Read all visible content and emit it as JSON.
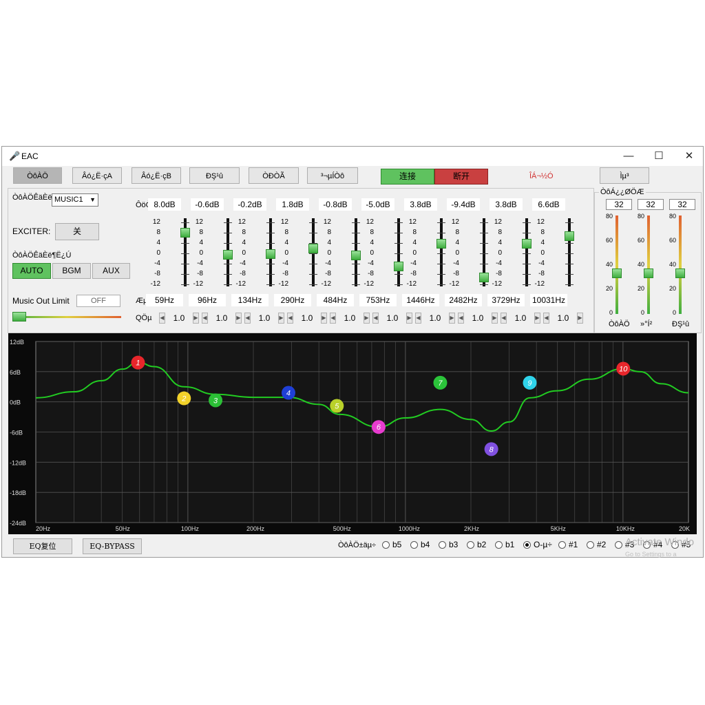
{
  "window": {
    "title": "EAC",
    "mic_icon": "microphone-icon"
  },
  "tabs": [
    {
      "label": "ÒôÀÖ"
    },
    {
      "label": "Âó¿Ë·çA"
    },
    {
      "label": "Âó¿Ë·çB"
    },
    {
      "label": "ÐŞ¹û"
    },
    {
      "label": "ÒÐÒÃ"
    },
    {
      "label": "³¬µÍÒô"
    }
  ],
  "connect_label": "连接",
  "disconnect_label": "断开",
  "status_text": "ÎÁ¬½Ó",
  "last_tab_label": "Ìµ³",
  "left_panel": {
    "source_label": "ÒôÀÖÊäÈë",
    "source_value": "MUSIC1",
    "exciter_label": "EXCITER:",
    "exciter_value": "关",
    "mode_label": "ÒôÀÖÊäÈë¶Ë¿Ú",
    "modes": [
      "AUTO",
      "BGM",
      "AUX"
    ],
    "active_mode": "AUTO",
    "limit_label": "Music Out Limit",
    "limit_value": "OFF"
  },
  "eq": {
    "gain_label": "ÔöÒæ",
    "freq_label": "ÆµÂÊ",
    "q_label": "QÖµ",
    "scale": [
      "12",
      "8",
      "4",
      "0",
      "-4",
      "-8",
      "-12"
    ],
    "bands": [
      {
        "gain": "8.0dB",
        "freq": "59Hz",
        "q": "1.0",
        "level": 8.0
      },
      {
        "gain": "-0.6dB",
        "freq": "96Hz",
        "q": "1.0",
        "level": -0.6
      },
      {
        "gain": "-0.2dB",
        "freq": "134Hz",
        "q": "1.0",
        "level": -0.2
      },
      {
        "gain": "1.8dB",
        "freq": "290Hz",
        "q": "1.0",
        "level": 1.8
      },
      {
        "gain": "-0.8dB",
        "freq": "484Hz",
        "q": "1.0",
        "level": -0.8
      },
      {
        "gain": "-5.0dB",
        "freq": "753Hz",
        "q": "1.0",
        "level": -5.0
      },
      {
        "gain": "3.8dB",
        "freq": "1446Hz",
        "q": "1.0",
        "level": 3.8
      },
      {
        "gain": "-9.4dB",
        "freq": "2482Hz",
        "q": "1.0",
        "level": -9.4
      },
      {
        "gain": "3.8dB",
        "freq": "3729Hz",
        "q": "1.0",
        "level": 3.8
      },
      {
        "gain": "6.6dB",
        "freq": "10031Hz",
        "q": "1.0",
        "level": 6.6
      }
    ]
  },
  "volume": {
    "title": "ÒôÁ¿¿ØÖÆ",
    "scale": [
      "80",
      "60",
      "40",
      "20",
      "0"
    ],
    "channels": [
      {
        "value": "32",
        "label": "ÒôÀÖ",
        "level": 32
      },
      {
        "value": "32",
        "label": "»°Í²",
        "level": 32
      },
      {
        "value": "32",
        "label": "ÐŞ¹û",
        "level": 32
      }
    ]
  },
  "graph": {
    "y_labels": [
      "12dB",
      "6dB",
      "0dB",
      "-6dB",
      "-12dB",
      "-18dB",
      "-24dB"
    ],
    "x_labels": [
      "20Hz",
      "50Hz",
      "100Hz",
      "200Hz",
      "500Hz",
      "1000Hz",
      "2KHz",
      "5KHz",
      "10KHz",
      "20K"
    ],
    "line_color": "#22cc22",
    "points": [
      {
        "n": "1",
        "color": "#e8262b",
        "freq": 59,
        "db": 7.8
      },
      {
        "n": "2",
        "color": "#f2d22a",
        "freq": 96,
        "db": 0.7
      },
      {
        "n": "3",
        "color": "#2bbf36",
        "freq": 134,
        "db": 0.3
      },
      {
        "n": "4",
        "color": "#1f3fd6",
        "freq": 290,
        "db": 1.8
      },
      {
        "n": "5",
        "color": "#b9d12a",
        "freq": 484,
        "db": -0.8
      },
      {
        "n": "6",
        "color": "#e83ccf",
        "freq": 753,
        "db": -5.0
      },
      {
        "n": "7",
        "color": "#2bc43a",
        "freq": 1446,
        "db": 3.8
      },
      {
        "n": "8",
        "color": "#8050e0",
        "freq": 2482,
        "db": -9.4
      },
      {
        "n": "9",
        "color": "#2fd3ea",
        "freq": 3729,
        "db": 3.8
      },
      {
        "n": "10",
        "color": "#e8262b",
        "freq": 10031,
        "db": 6.6
      }
    ],
    "curve": [
      [
        20,
        0.8
      ],
      [
        30,
        2.0
      ],
      [
        40,
        4.2
      ],
      [
        50,
        6.5
      ],
      [
        59,
        7.9
      ],
      [
        70,
        7.0
      ],
      [
        96,
        3.0
      ],
      [
        134,
        1.5
      ],
      [
        200,
        0.9
      ],
      [
        290,
        0.9
      ],
      [
        400,
        -0.5
      ],
      [
        500,
        -2.5
      ],
      [
        753,
        -5.0
      ],
      [
        1000,
        -3.2
      ],
      [
        1446,
        -1.5
      ],
      [
        2000,
        -3.5
      ],
      [
        2482,
        -5.8
      ],
      [
        3000,
        -4.0
      ],
      [
        3729,
        0.8
      ],
      [
        5000,
        2.2
      ],
      [
        7000,
        4.5
      ],
      [
        10031,
        6.6
      ],
      [
        12000,
        6.0
      ],
      [
        15000,
        3.6
      ],
      [
        20000,
        1.8
      ]
    ]
  },
  "bottom": {
    "reset_label": "EQ复位",
    "bypass_label": "EQ-BYPASS",
    "preset_label": "ÒôÀÖ±äµ÷",
    "presets": [
      "b5",
      "b4",
      "b3",
      "b2",
      "b1",
      "O-µ÷",
      "#1",
      "#2",
      "#3",
      "#4",
      "#5"
    ],
    "selected_preset": "O-µ÷"
  },
  "watermark": {
    "line1": "Activate Windo",
    "line2": "Go to Settings to a"
  }
}
